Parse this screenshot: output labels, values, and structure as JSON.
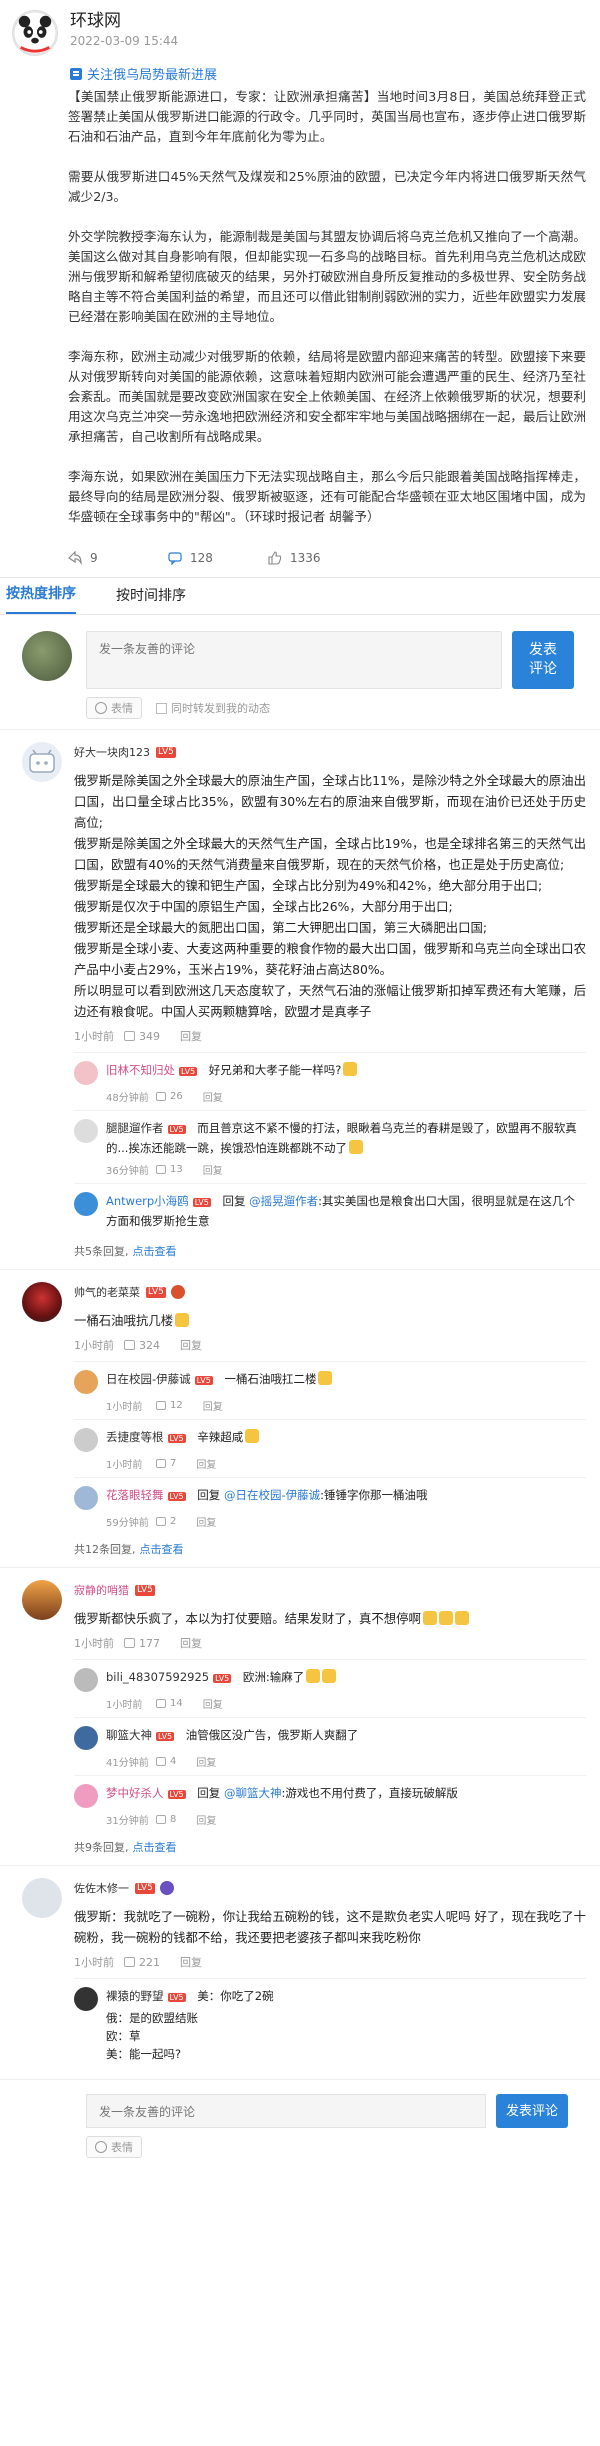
{
  "post": {
    "author": "环球网",
    "time": "2022-03-09 15:44",
    "topic": "关注俄乌局势最新进展",
    "paragraphs": [
      "【美国禁止俄罗斯能源进口，专家：让欧洲承担痛苦】当地时间3月8日，美国总统拜登正式签署禁止美国从俄罗斯进口能源的行政令。几乎同时，英国当局也宣布，逐步停止进口俄罗斯石油和石油产品，直到今年年底前化为零为止。",
      "需要从俄罗斯进口45%天然气及煤炭和25%原油的欧盟，已决定今年内将进口俄罗斯天然气减少2/3。",
      "外交学院教授李海东认为，能源制裁是美国与其盟友协调后将乌克兰危机又推向了一个高潮。美国这么做对其自身影响有限，但却能实现一石多鸟的战略目标。首先利用乌克兰危机达成欧洲与俄罗斯和解希望彻底破灭的结果，另外打破欧洲自身所反复推动的多极世界、安全防务战略自主等不符合美国利益的希望，而且还可以借此钳制削弱欧洲的实力，近些年欧盟实力发展已经潜在影响美国在欧洲的主导地位。",
      "李海东称，欧洲主动减少对俄罗斯的依赖，结局将是欧盟内部迎来痛苦的转型。欧盟接下来要从对俄罗斯转向对美国的能源依赖，这意味着短期内欧洲可能会遭遇严重的民生、经济乃至社会紊乱。而美国就是要改变欧洲国家在安全上依赖美国、在经济上依赖俄罗斯的状况，想要利用这次乌克兰冲突一劳永逸地把欧洲经济和安全都牢牢地与美国战略捆绑在一起，最后让欧洲承担痛苦，自己收割所有战略成果。",
      "李海东说，如果欧洲在美国压力下无法实现战略自主，那么今后只能跟着美国战略指挥棒走，最终导向的结局是欧洲分裂、俄罗斯被驱逐，还有可能配合华盛顿在亚太地区围堵中国，成为华盛顿在全球事务中的\"帮凶\"。（环球时报记者 胡馨予）"
    ],
    "actions": {
      "reposts": "9",
      "comments": "128",
      "likes": "1336"
    }
  },
  "sort_tabs": [
    "按热度排序",
    "按时间排序"
  ],
  "composer": {
    "placeholder": "发一条友善的评论",
    "submit": "发表\n评论",
    "emoji": "表情",
    "share": "同时转发到我的动态"
  },
  "comments": [
    {
      "user": "好大一块肉123",
      "level": "LV5",
      "lines": [
        "俄罗斯是除美国之外全球最大的原油生产国，全球占比11%，是除沙特之外全球最大的原油出口国，出口量全球占比35%，欧盟有30%左右的原油来自俄罗斯，而现在油价已还处于历史高位;",
        "俄罗斯是除美国之外全球最大的天然气生产国，全球占比19%，也是全球排名第三的天然气出口国，欧盟有40%的天然气消费量来自俄罗斯，现在的天然气价格，也正是处于历史高位;",
        "俄罗斯是全球最大的镍和钯生产国，全球占比分别为49%和42%，绝大部分用于出口;",
        "俄罗斯是仅次于中国的原铝生产国，全球占比26%，大部分用于出口;",
        "俄罗斯还是全球最大的氮肥出口国，第二大钾肥出口国，第三大磷肥出口国;",
        "俄罗斯是全球小麦、大麦这两种重要的粮食作物的最大出口国，俄罗斯和乌克兰向全球出口农产品中小麦占29%，玉米占19%，葵花籽油占高达80%。",
        "所以明显可以看到欧洲这几天态度软了，天然气石油的涨幅让俄罗斯扣掉军费还有大笔赚，后边还有粮食呢。中国人买两颗糖算啥，欧盟才是真孝子"
      ],
      "ago": "1小时前",
      "likes": "349",
      "reply_label": "回复",
      "replies": [
        {
          "user": "旧林不知归处",
          "level": "LV5",
          "text": "好兄弟和大孝子能一样吗?",
          "ago": "48分钟前",
          "likes": "26",
          "reply": "回复"
        },
        {
          "user": "腿腿遛作者",
          "level": "LV5",
          "text": "而且普京这不紧不慢的打法，眼瞅着乌克兰的春耕是毁了，欧盟再不服软真的...挨冻还能跳一跳，挨饿恐怕连跳都跳不动了",
          "ago": "36分钟前",
          "likes": "13",
          "reply": "回复"
        },
        {
          "user": "Antwerp小海鸥",
          "level": "LV5",
          "prefix": "回复",
          "at": "@摇晃遛作者",
          "text": ":其实美国也是粮食出口大国，很明显就是在这几个方面和俄罗斯抢生意",
          "ago": "",
          "likes": "",
          "reply": ""
        }
      ],
      "total": "共5条回复,",
      "more": "点击查看"
    },
    {
      "user": "帅气的老菜菜",
      "level": "LV5",
      "lines": [
        "一桶石油哦抗几楼"
      ],
      "ago": "1小时前",
      "likes": "324",
      "reply_label": "回复",
      "replies": [
        {
          "user": "日在校园-伊藤诚",
          "level": "LV5",
          "text": "一桶石油哦扛二楼",
          "ago": "1小时前",
          "likes": "12",
          "reply": "回复"
        },
        {
          "user": "丢捷度等根",
          "level": "LV5",
          "text": "辛辣超咸",
          "ago": "1小时前",
          "likes": "7",
          "reply": "回复"
        },
        {
          "user": "花落眼轻舞",
          "level": "LV5",
          "prefix": "回复",
          "at": "@日在校园-伊藤诚",
          "text": ":锤锤字你那一桶油哦",
          "ago": "59分钟前",
          "likes": "2",
          "reply": "回复"
        }
      ],
      "total": "共12条回复,",
      "more": "点击查看"
    },
    {
      "user": "寂静的哨猎",
      "level": "LV5",
      "lines": [
        "俄罗斯都快乐疯了，本以为打仗要赔。结果发财了，真不想停啊"
      ],
      "ago": "1小时前",
      "likes": "177",
      "reply_label": "回复",
      "replies": [
        {
          "user": "bili_48307592925",
          "level": "LV5",
          "text": "欧洲:输麻了",
          "ago": "1小时前",
          "likes": "14",
          "reply": "回复"
        },
        {
          "user": "聊篮大神",
          "level": "LV5",
          "text": "油管俄区没广告，俄罗斯人爽翻了",
          "ago": "41分钟前",
          "likes": "4",
          "reply": "回复"
        },
        {
          "user": "梦中好杀人",
          "level": "LV5",
          "prefix": "回复",
          "at": "@聊篮大神",
          "text": ":游戏也不用付费了，直接玩破解版",
          "ago": "31分钟前",
          "likes": "8",
          "reply": "回复"
        }
      ],
      "total": "共9条回复,",
      "more": "点击查看"
    },
    {
      "user": "佐佐木修一",
      "level": "LV5",
      "lines": [
        "俄罗斯：我就吃了一碗粉，你让我给五碗粉的钱，这不是欺负老实人呢吗 好了，现在我吃了十碗粉，我一碗粉的钱都不给，我还要把老婆孩子都叫来我吃粉你"
      ],
      "ago": "1小时前",
      "likes": "221",
      "reply_label": "回复",
      "replies": [
        {
          "user": "裸猿的野望",
          "level": "LV5",
          "text": "美：你吃了2碗",
          "ago": "",
          "likes": "",
          "reply": "",
          "dialog": [
            "俄：是的欧盟结账",
            "欧：草",
            "美：能一起吗?"
          ]
        }
      ],
      "total": "",
      "more": ""
    }
  ],
  "bottom_composer": {
    "placeholder": "发一条友善的评论",
    "submit": "发表评论",
    "emoji": "表情"
  }
}
